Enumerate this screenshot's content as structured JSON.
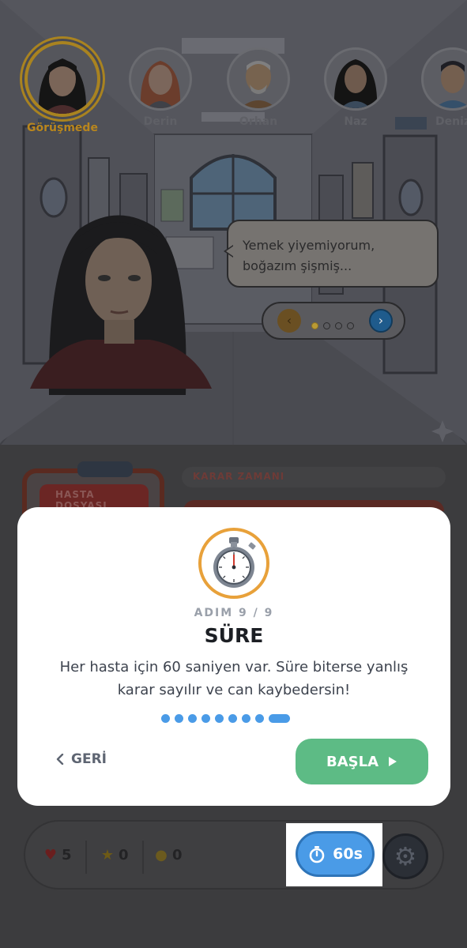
{
  "characters": [
    {
      "name": "Görüşmede",
      "active": true,
      "hair": "#151515",
      "skin": "#e3b998"
    },
    {
      "name": "Derin",
      "active": false,
      "hair": "#a64a28",
      "skin": "#e6b692"
    },
    {
      "name": "Orhan",
      "active": false,
      "hair": "#cfcfcf",
      "skin": "#d6a47c"
    },
    {
      "name": "Naz",
      "active": false,
      "hair": "#141414",
      "skin": "#c99270"
    },
    {
      "name": "Deniz",
      "active": false,
      "hair": "#1e1e24",
      "skin": "#d29a72"
    }
  ],
  "dialogue": {
    "text": "Yemek yiyemiyorum, boğazım şişmiş...",
    "page_count": 4,
    "current_page": 1,
    "prev_icon": "‹",
    "next_icon": "›"
  },
  "background_panel": {
    "dossier_label": "HASTA DOSYASI",
    "decision_label": "KARAR ZAMANI"
  },
  "modal": {
    "icon": "stopwatch-icon",
    "step": "ADIM 9 / 9",
    "title": "SÜRE",
    "body": "Her hasta için 60 saniyen var. Süre biterse yanlış karar sayılır ve can kaybedersin!",
    "total_steps": 9,
    "current_step": 9,
    "back_label": "GERİ",
    "start_label": "BAŞLA",
    "accent": "#4a9be7",
    "start_color": "#5dbb85"
  },
  "status": {
    "lives": "5",
    "stars": "0",
    "coins": "0",
    "timer": "60s"
  }
}
